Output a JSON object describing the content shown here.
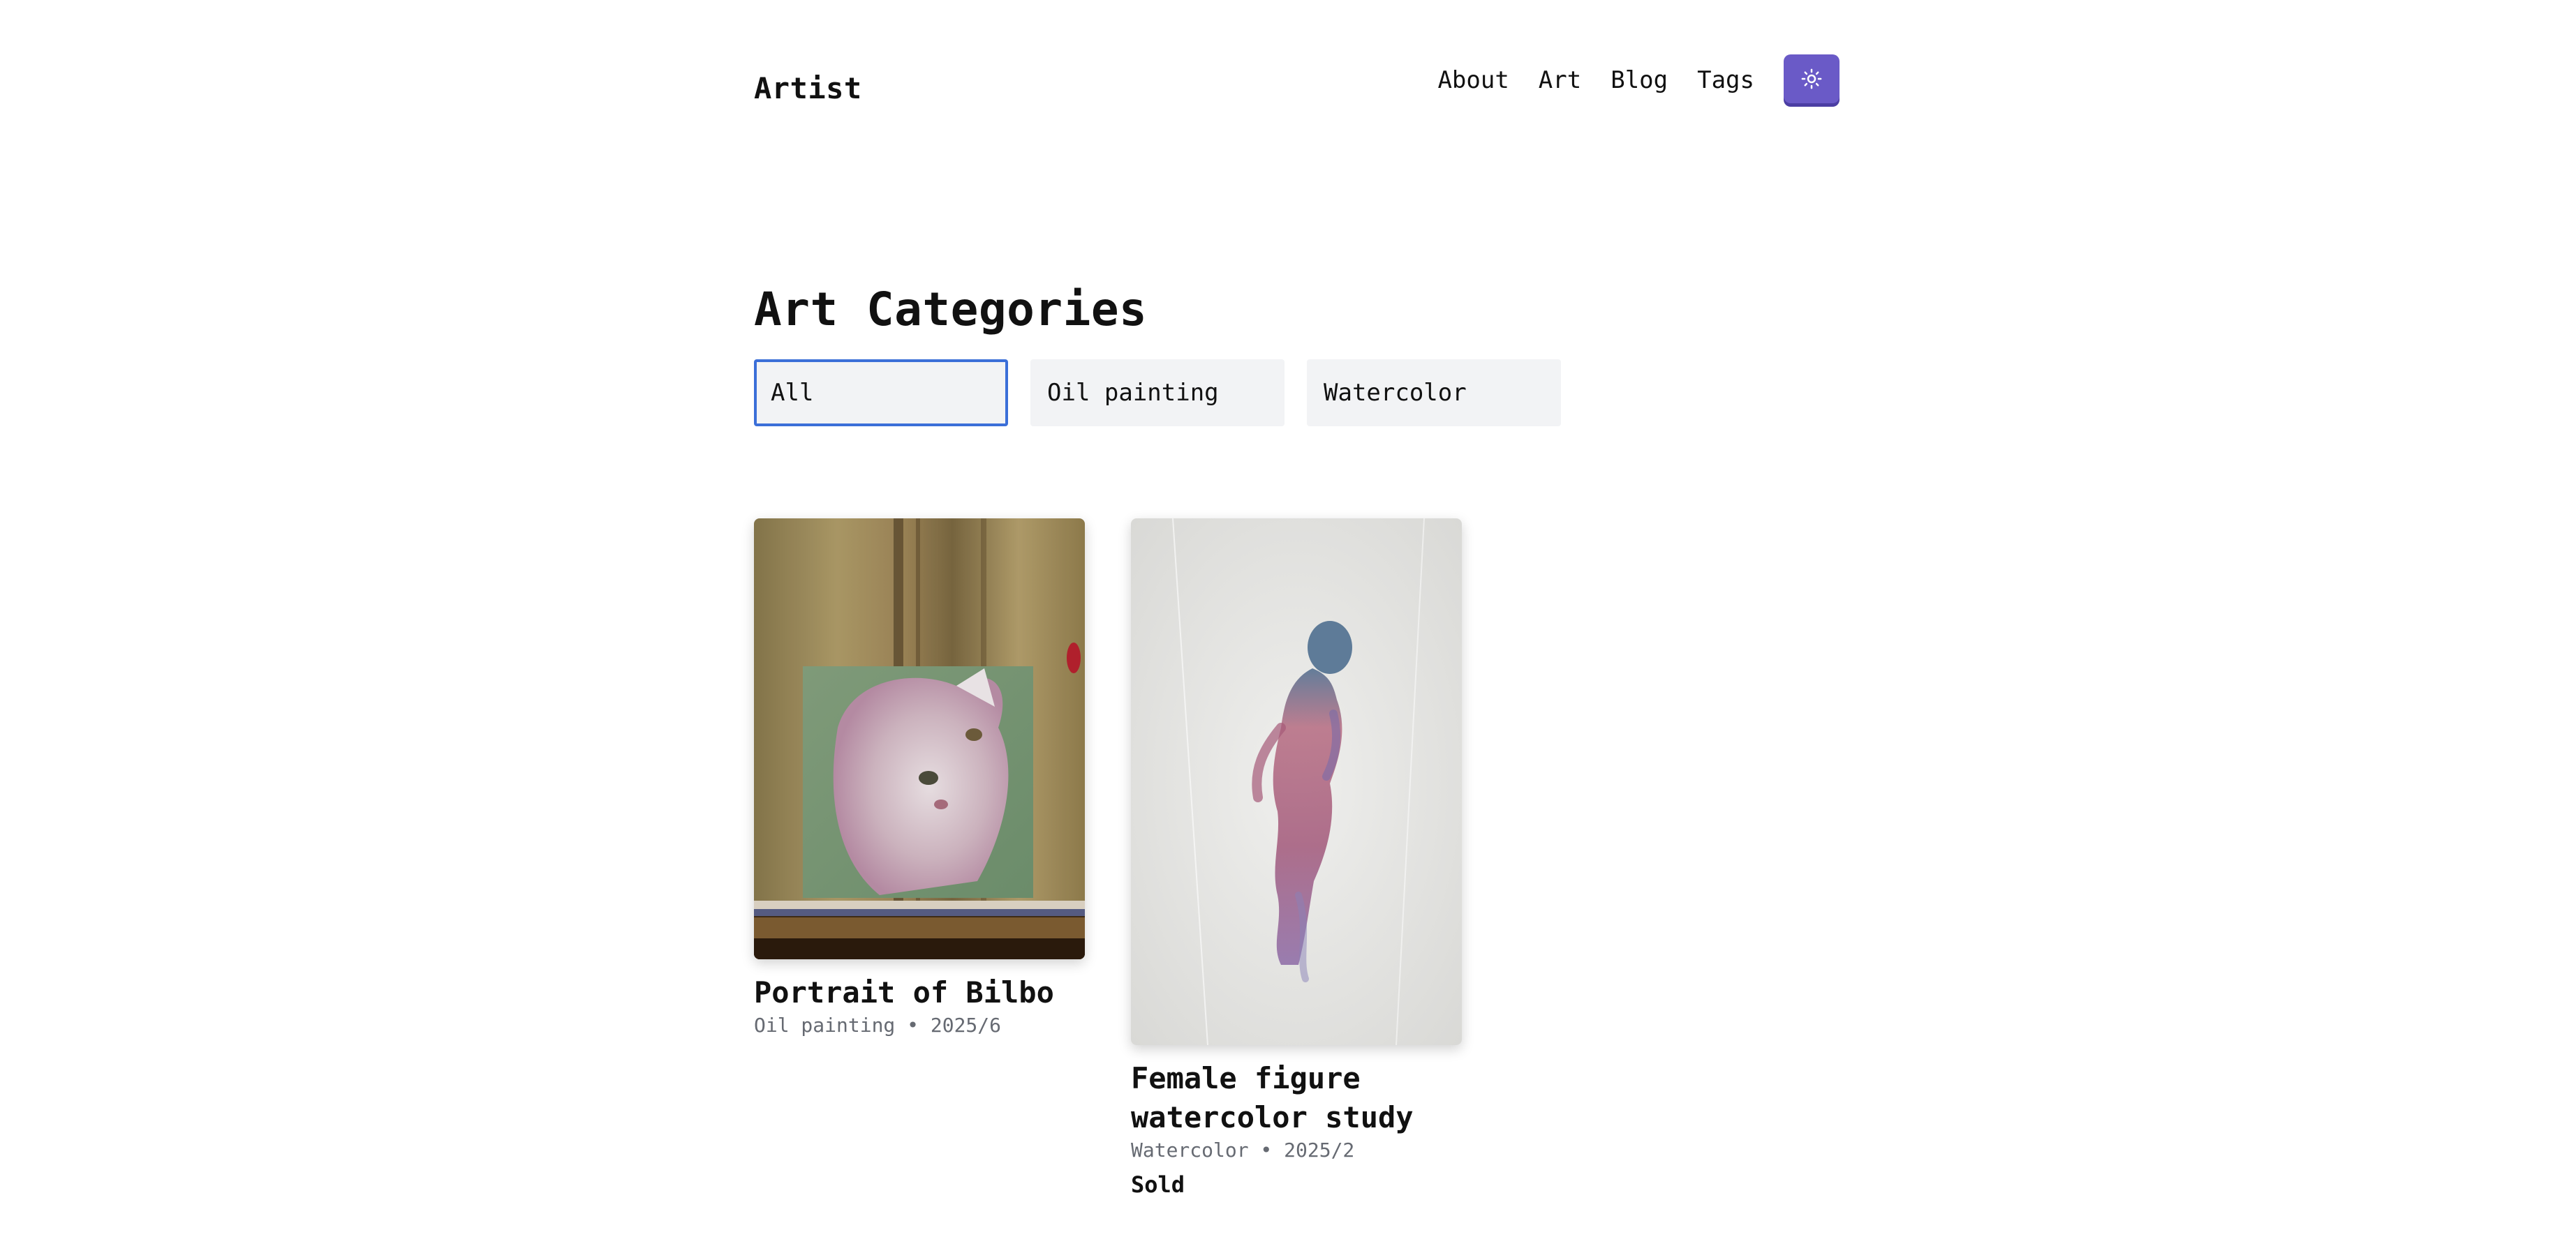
{
  "header": {
    "site_title": "Artist",
    "nav": [
      {
        "label": "About"
      },
      {
        "label": "Art"
      },
      {
        "label": "Blog"
      },
      {
        "label": "Tags"
      }
    ],
    "theme_toggle_icon": "sun-icon",
    "accent_color": "#6a5ac7"
  },
  "main": {
    "title": "Art Categories",
    "filters": [
      {
        "label": "All",
        "active": true
      },
      {
        "label": "Oil painting",
        "active": false
      },
      {
        "label": "Watercolor",
        "active": false
      }
    ],
    "artworks": [
      {
        "title": "Portrait of Bilbo",
        "category": "Oil painting",
        "date": "2025/6",
        "meta": "Oil painting • 2025/6",
        "status": ""
      },
      {
        "title": "Female figure watercolor study",
        "category": "Watercolor",
        "date": "2025/2",
        "meta": "Watercolor • 2025/2",
        "status": "Sold"
      }
    ]
  }
}
